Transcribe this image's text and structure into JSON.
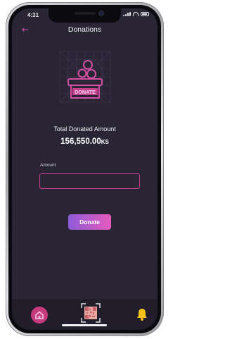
{
  "status_bar": {
    "time": "4:31",
    "icons": [
      "location-arrow-icon",
      "signal-icon",
      "wifi-icon",
      "battery-icon"
    ]
  },
  "header": {
    "title": "Donations",
    "back_icon": "back-arrow-icon"
  },
  "illustration": {
    "box_label": "DONATE",
    "icon": "donation-box-icon"
  },
  "summary": {
    "label": "Total Donated Amount",
    "amount": "156,550.00",
    "currency": "KS"
  },
  "form": {
    "amount_label": "Amount",
    "amount_value": "",
    "amount_placeholder": "",
    "donate_label": "Donate"
  },
  "tab_bar": {
    "items": [
      {
        "name": "home",
        "icon": "home-icon"
      },
      {
        "name": "qr-scan",
        "icon": "qr-scan-icon"
      },
      {
        "name": "notifications",
        "icon": "bell-icon"
      }
    ]
  },
  "colors": {
    "background": "#292534",
    "accent_pink": "#e54fb0",
    "accent_purple": "#8e5bd8",
    "input_border": "#c13e8e",
    "bell_yellow": "#f4c21b",
    "tab_bar": "#211d2b"
  }
}
